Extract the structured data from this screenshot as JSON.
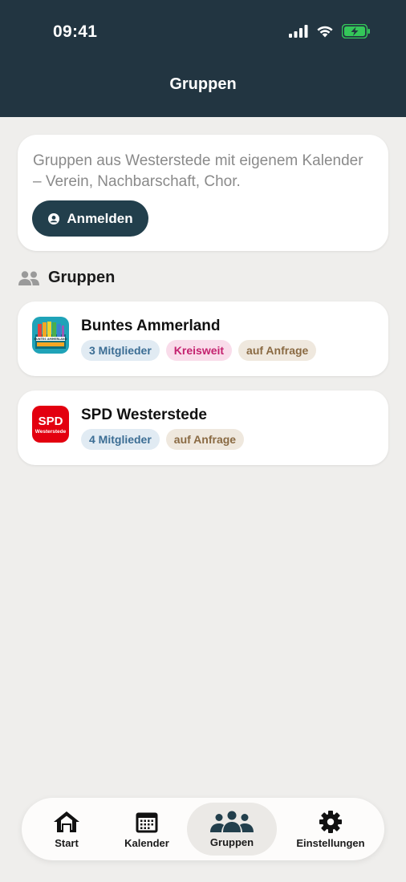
{
  "status_bar": {
    "time": "09:41"
  },
  "header": {
    "title": "Gruppen"
  },
  "intro": {
    "text": "Gruppen aus Westerstede mit eigenem Kalender – Verein, Nachbarschaft, Chor.",
    "login_label": "Anmelden"
  },
  "section": {
    "title": "Gruppen"
  },
  "groups": [
    {
      "name": "Buntes Ammerland",
      "logo_text": "BUNTES AMMERLAND",
      "tags": [
        "3 Mitglieder",
        "Kreisweit",
        "auf Anfrage"
      ]
    },
    {
      "name": "SPD Westerstede",
      "logo_text": "SPD",
      "logo_subtext": "Westerstede",
      "tags": [
        "4 Mitglieder",
        "auf Anfrage"
      ]
    }
  ],
  "tabbar": {
    "items": [
      {
        "label": "Start",
        "icon": "home-icon"
      },
      {
        "label": "Kalender",
        "icon": "calendar-icon"
      },
      {
        "label": "Gruppen",
        "icon": "groups-icon",
        "active": true
      },
      {
        "label": "Einstellungen",
        "icon": "gear-icon"
      }
    ]
  },
  "colors": {
    "header_bg": "#223541",
    "primary_button": "#223f4c",
    "page_bg": "#efeeec",
    "battery": "#34c759"
  }
}
